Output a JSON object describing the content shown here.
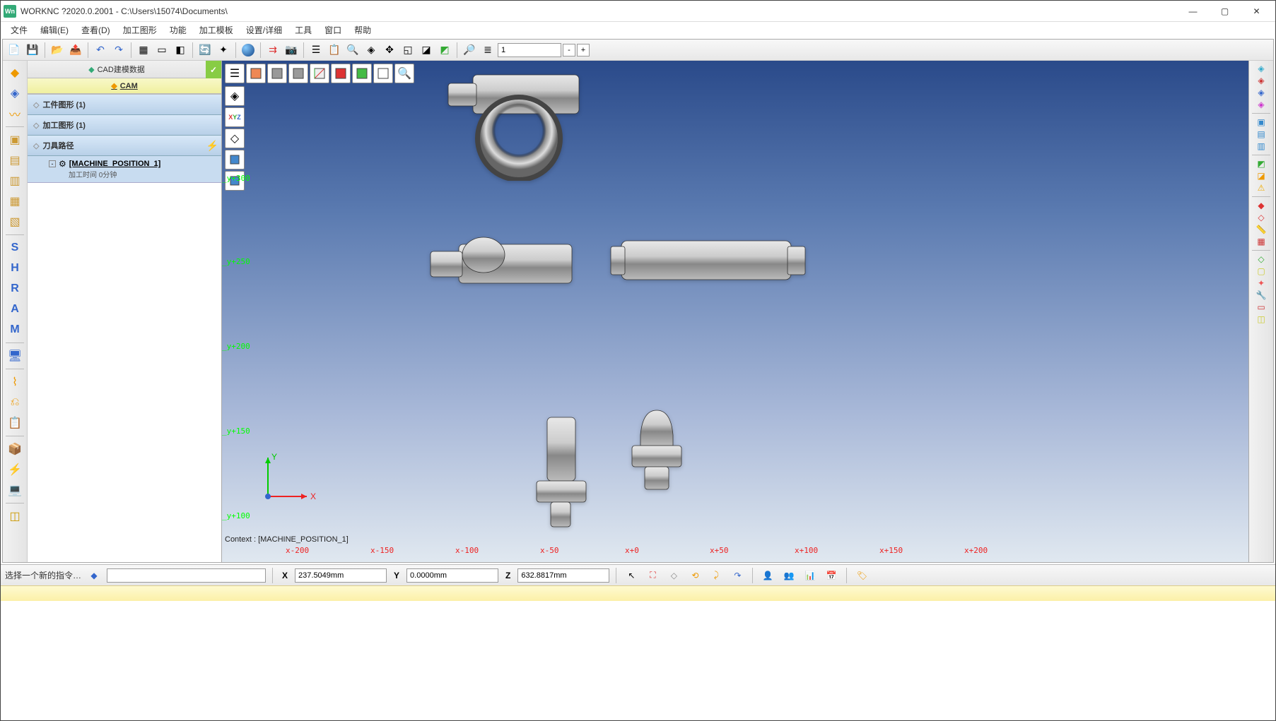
{
  "titlebar": {
    "app_icon": "Wn",
    "title": "WORKNC ?2020.0.2001 - C:\\Users\\15074\\Documents\\"
  },
  "menubar": {
    "items": [
      "文件",
      "编辑(E)",
      "查看(D)",
      "加工图形",
      "功能",
      "加工模板",
      "设置/详细",
      "工具",
      "窗口",
      "帮助"
    ]
  },
  "toolbar": {
    "layer_value": "1",
    "minus": "-",
    "plus": "+"
  },
  "tree": {
    "header_tab": "CAD建模数据",
    "sub_tab": "CAM",
    "sections": [
      {
        "label": "工件图形 (1)"
      },
      {
        "label": "加工图形 (1)"
      },
      {
        "label": "刀具路径"
      }
    ],
    "machine_pos": "[MACHINE_POSITION_1]",
    "machine_sub": "加工时间 0分钟"
  },
  "viewport": {
    "context": "Context : [MACHINE_POSITION_1]",
    "y_labels": [
      "_y+300",
      "_y+250",
      "_y+200",
      "_y+150",
      "_y+100"
    ],
    "x_labels": [
      "x-200",
      "x-150",
      "x-100",
      "x-50",
      "x+0",
      "x+50",
      "x+100",
      "x+150",
      "x+200"
    ],
    "axis_x": "X",
    "axis_y": "Y",
    "xyz_label": "XYZ"
  },
  "cmdbar": {
    "prompt": "选择一个新的指令…",
    "X": "X",
    "Y": "Y",
    "Z": "Z",
    "x_val": "237.5049mm",
    "y_val": "0.0000mm",
    "z_val": "632.8817mm"
  }
}
